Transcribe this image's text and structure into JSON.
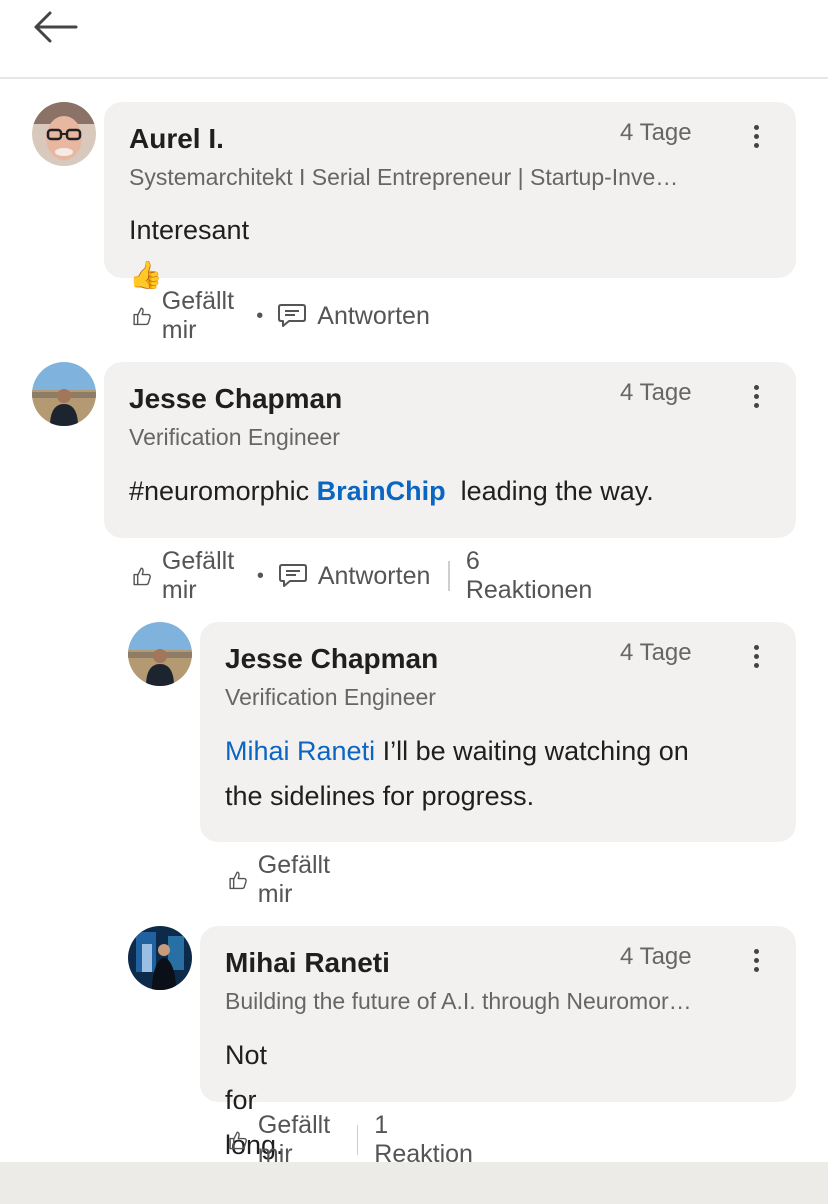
{
  "comments": [
    {
      "name": "Aurel I.",
      "headline": "Systemarchitekt I Serial Entrepreneur | Startup-Inve…",
      "time": "4 Tage",
      "text": "Interesant 👍",
      "like_label": "Gefällt mir",
      "reply_label": "Antworten"
    },
    {
      "name": "Jesse Chapman",
      "headline": "Verification Engineer",
      "time": "4 Tage",
      "text_prefix": "#neuromorphic ",
      "mention": "BrainChip",
      "text_suffix": "  leading the way.",
      "like_label": "Gefällt mir",
      "reply_label": "Antworten",
      "reactions": "6 Reaktionen"
    }
  ],
  "replies": [
    {
      "name": "Jesse Chapman",
      "headline": "Verification Engineer",
      "time": "4 Tage",
      "mention": "Mihai Raneti",
      "text_line1": " I’ll be waiting watching on",
      "text_line2": "the sidelines for progress.",
      "like_label": "Gefällt mir"
    },
    {
      "name": "Mihai Raneti",
      "headline": "Building the future of A.I. through Neuromor…",
      "time": "4 Tage",
      "text": "Not for long.",
      "like_label": "Gefällt mir",
      "reactions": "1 Reaktion"
    }
  ],
  "colors": {
    "bubble": "#f2f1ef",
    "mention": "#0a66c2",
    "muted": "#666666"
  },
  "icons": [
    "back-arrow-icon",
    "more-options-icon",
    "like-thumb-icon",
    "reply-bubble-icon"
  ]
}
